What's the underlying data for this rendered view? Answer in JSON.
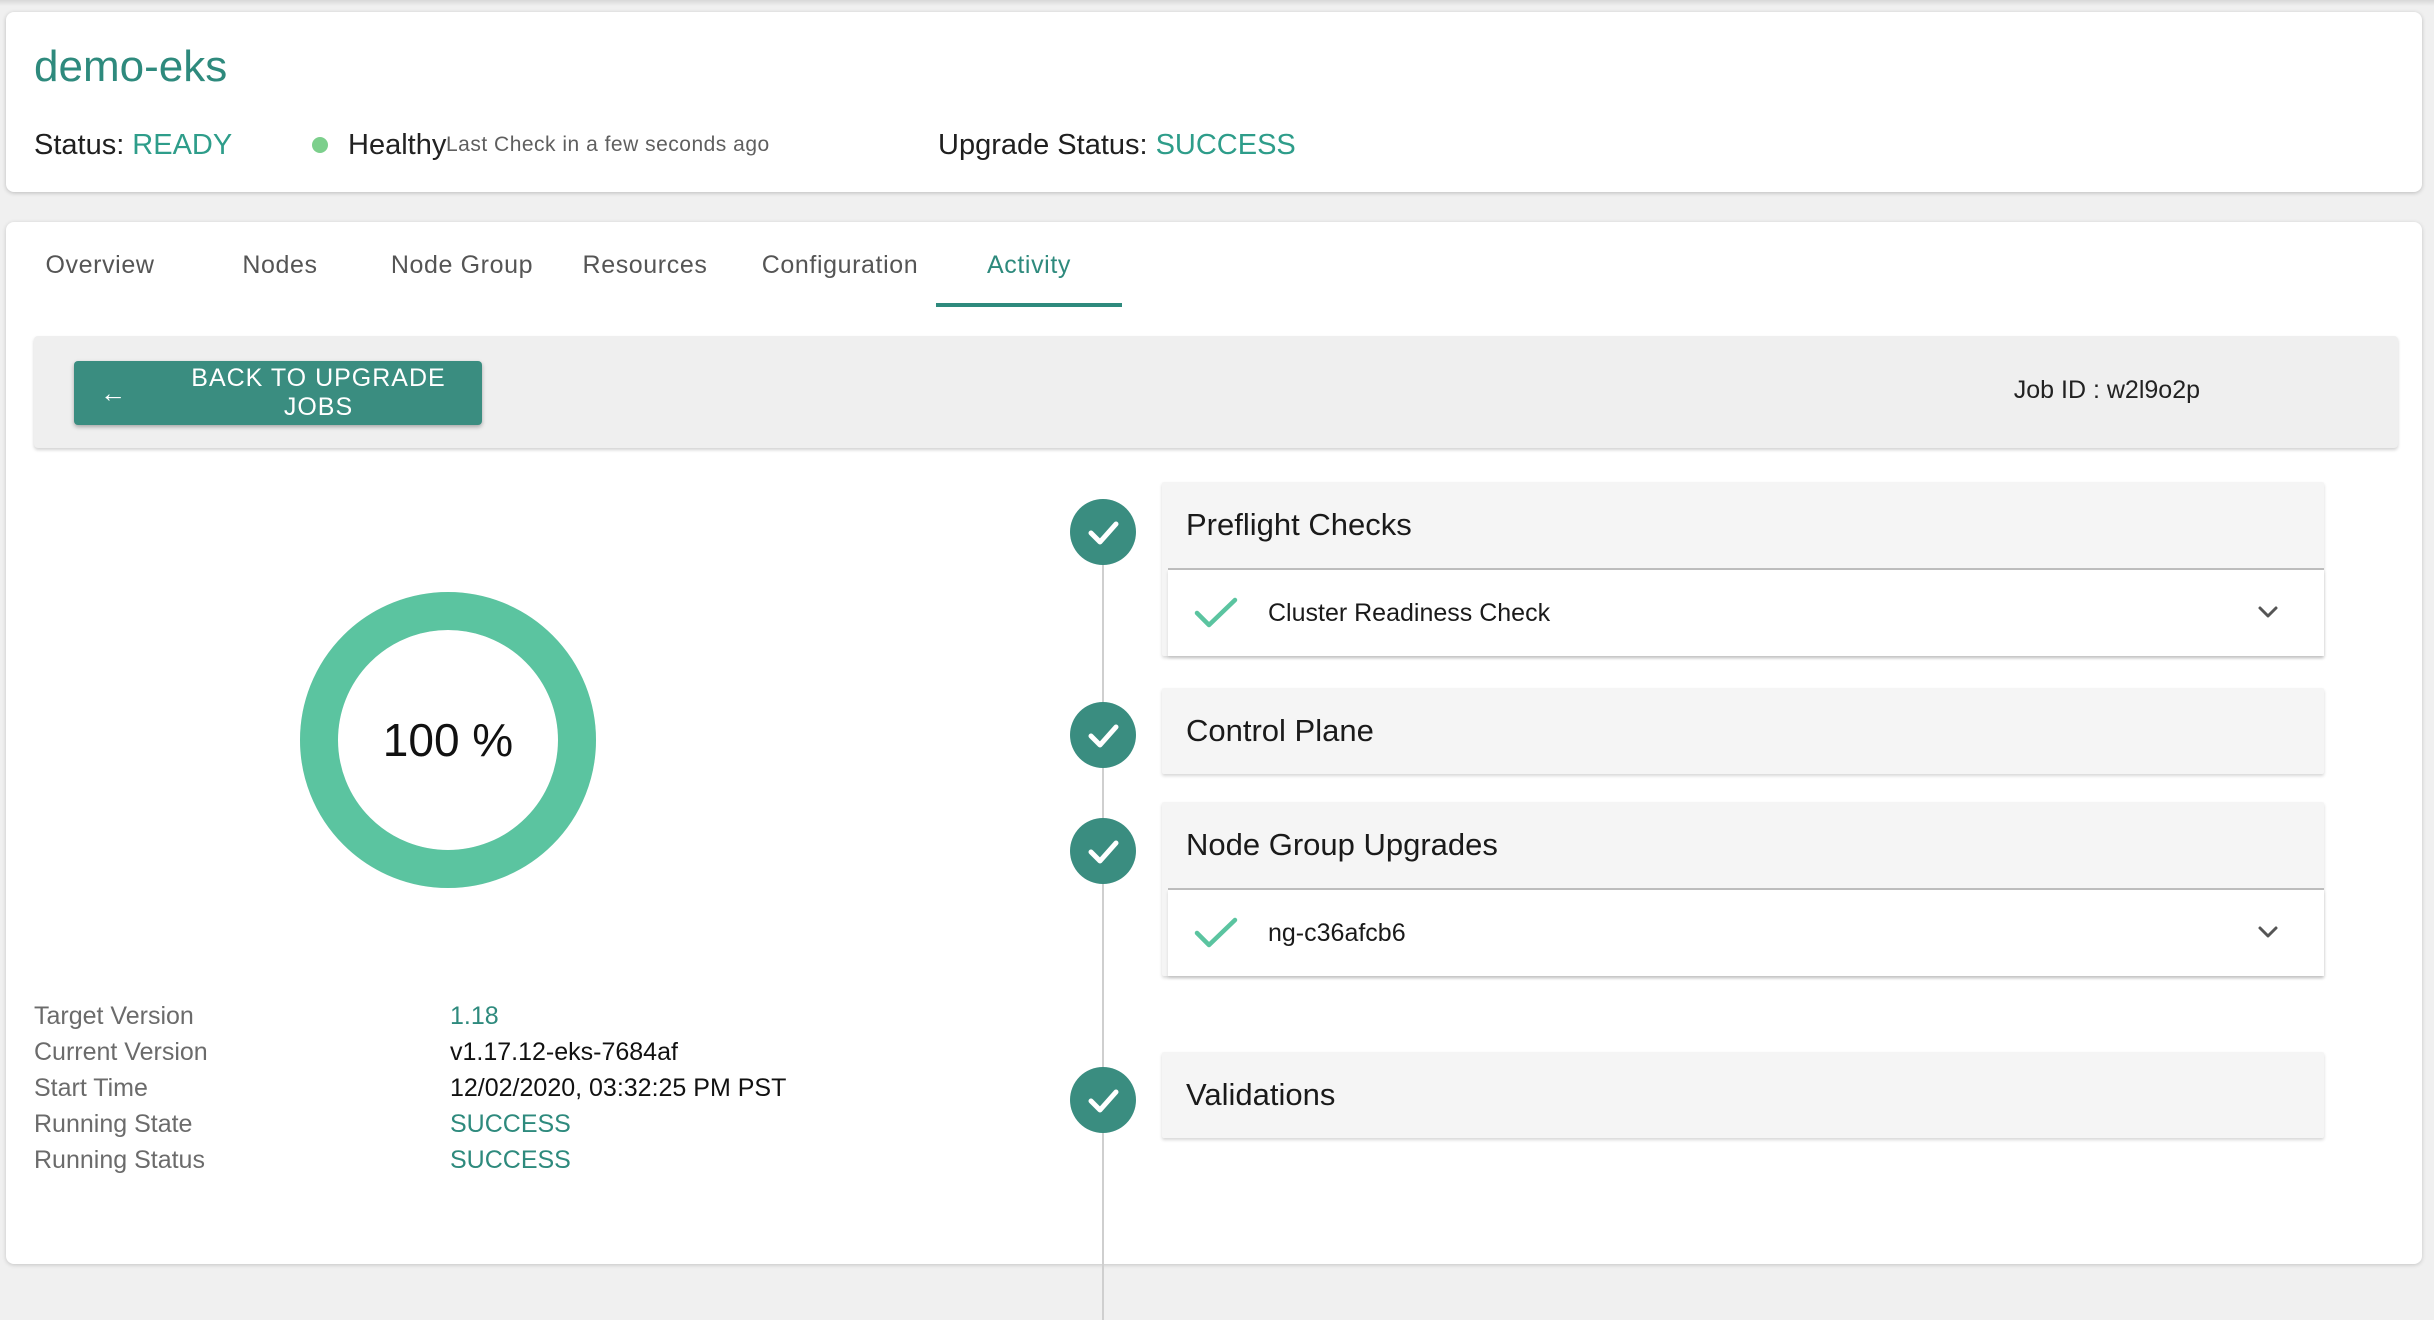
{
  "header": {
    "cluster_name": "demo-eks",
    "status_label": "Status:",
    "status_value": "READY",
    "health_text": "Healthy",
    "last_check": "Last Check in a few seconds ago",
    "upgrade_status_label": "Upgrade Status:",
    "upgrade_status_value": "SUCCESS",
    "health_color": "#7ccf8c"
  },
  "tabs": [
    {
      "label": "Overview"
    },
    {
      "label": "Nodes"
    },
    {
      "label": "Node Group"
    },
    {
      "label": "Resources"
    },
    {
      "label": "Configuration"
    },
    {
      "label": "Activity",
      "active": true
    }
  ],
  "toolbar": {
    "back_icon": "arrow-left-icon",
    "back_label": "BACK TO UPGRADE JOBS",
    "job_id": "Job ID : w2l9o2p"
  },
  "progress": {
    "percent": 100,
    "label": "100 %",
    "ring_color": "#5bc4a0"
  },
  "details": [
    {
      "label": "Target Version",
      "value": "1.18",
      "teal": true
    },
    {
      "label": "Current Version",
      "value": "v1.17.12-eks-7684af",
      "teal": false
    },
    {
      "label": "Start Time",
      "value": "12/02/2020, 03:32:25 PM PST",
      "teal": false
    },
    {
      "label": "Running State",
      "value": "SUCCESS",
      "teal": true
    },
    {
      "label": "Running Status",
      "value": "SUCCESS",
      "teal": true
    }
  ],
  "steps": [
    {
      "title": "Preflight Checks",
      "status_icon": "check-circle-icon",
      "sub": [
        {
          "label": "Cluster Readiness Check"
        }
      ]
    },
    {
      "title": "Control Plane",
      "status_icon": "check-circle-icon",
      "sub": []
    },
    {
      "title": "Node Group Upgrades",
      "status_icon": "check-circle-icon",
      "sub": [
        {
          "label": "ng-c36afcb6"
        }
      ]
    },
    {
      "title": "Validations",
      "status_icon": "check-circle-icon",
      "sub": []
    }
  ],
  "colors": {
    "accent": "#2e8a7d",
    "button": "#3a8d80",
    "success_check": "#5bc4a0"
  }
}
